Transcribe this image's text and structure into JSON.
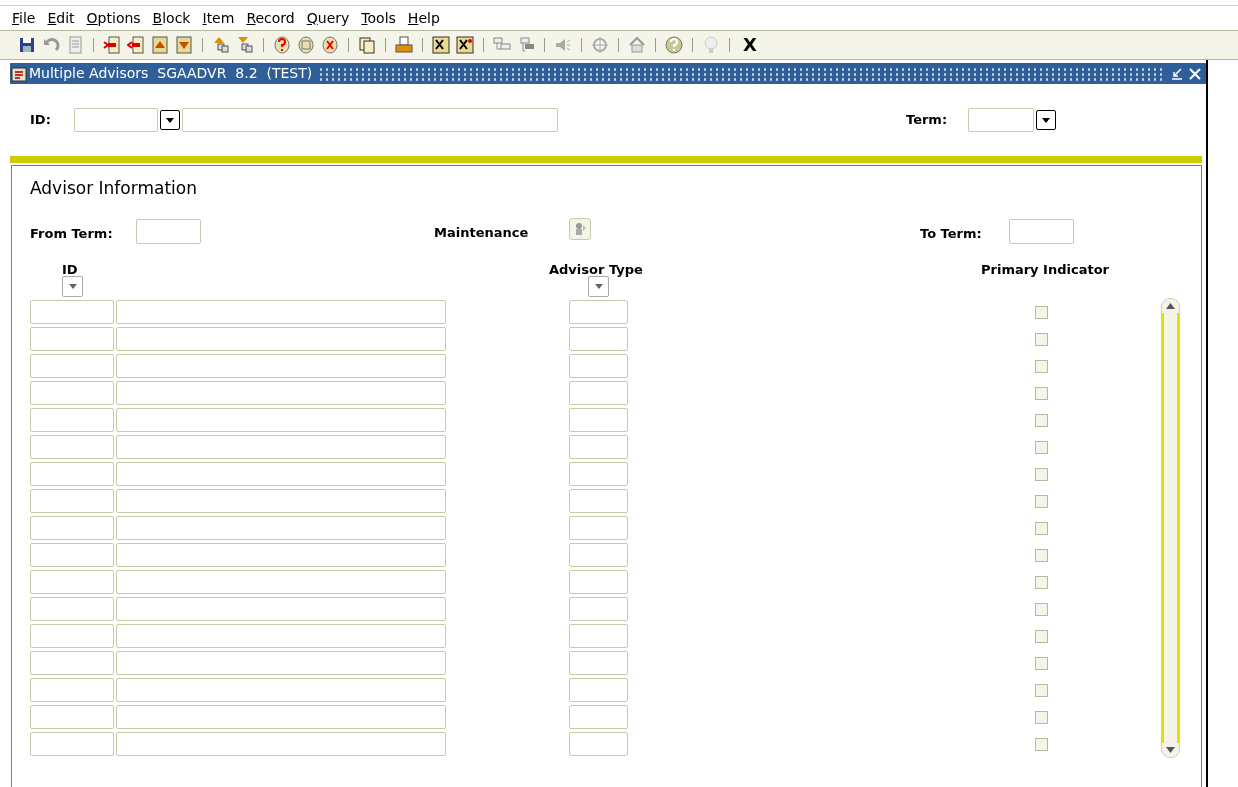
{
  "menu": [
    "File",
    "Edit",
    "Options",
    "Block",
    "Item",
    "Record",
    "Query",
    "Tools",
    "Help"
  ],
  "toolbar": {
    "exit_label": "X"
  },
  "window": {
    "title": "Multiple Advisors  SGAADVR  8.2  (TEST)"
  },
  "key_block": {
    "id_label": "ID:",
    "term_label": "Term:"
  },
  "section": {
    "title": "Advisor Information",
    "from_term_label": "From Term:",
    "maintenance_label": "Maintenance",
    "to_term_label": "To Term:",
    "columns": [
      "ID",
      "Advisor Type",
      "Primary Indicator"
    ],
    "rows": [
      {
        "checked": false
      },
      {
        "checked": false
      },
      {
        "checked": false
      },
      {
        "checked": false
      },
      {
        "checked": false
      },
      {
        "checked": false
      },
      {
        "checked": false
      },
      {
        "checked": false
      },
      {
        "checked": false
      },
      {
        "checked": false
      },
      {
        "checked": false
      },
      {
        "checked": false
      },
      {
        "checked": false
      },
      {
        "checked": false
      },
      {
        "checked": false
      },
      {
        "checked": false
      },
      {
        "checked": false
      }
    ]
  }
}
